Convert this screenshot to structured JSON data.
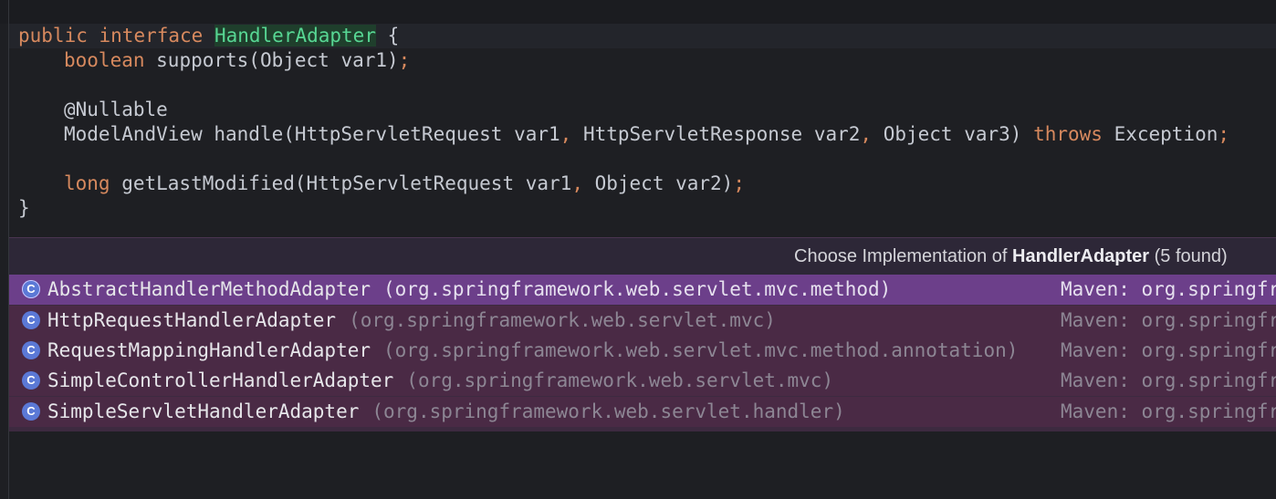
{
  "code": {
    "line1": {
      "kw1": "public",
      "kw2": "interface",
      "cls": "HandlerAdapter",
      "rest": " {"
    },
    "line2": {
      "type": "boolean",
      "rest": " supports(Object var1)",
      "semi": ";"
    },
    "line3": {
      "annotation": "@Nullable"
    },
    "line4": {
      "a": "ModelAndView handle(HttpServletRequest var1",
      "c1": ",",
      "b": " HttpServletResponse var2",
      "c2": ",",
      "d": " Object var3) ",
      "throws": "throws",
      "e": " Exception",
      "semi": ";"
    },
    "line5": {
      "type": "long",
      "a": " getLastModified(HttpServletRequest var1",
      "c1": ",",
      "b": " Object var2)",
      "semi": ";"
    },
    "line6": {
      "brace": "}"
    }
  },
  "popup": {
    "title_prefix": "Choose Implementation of ",
    "title_bold": "HandlerAdapter",
    "title_suffix": " (5 found)",
    "icon_letter": "C",
    "items": [
      {
        "name": "AbstractHandlerMethodAdapter",
        "package": "(org.springframework.web.servlet.mvc.method)",
        "library": "Maven: org.springframework"
      },
      {
        "name": "HttpRequestHandlerAdapter",
        "package": "(org.springframework.web.servlet.mvc)",
        "library": "Maven: org.springframework"
      },
      {
        "name": "RequestMappingHandlerAdapter",
        "package": "(org.springframework.web.servlet.mvc.method.annotation)",
        "library": "Maven: org.springframework"
      },
      {
        "name": "SimpleControllerHandlerAdapter",
        "package": "(org.springframework.web.servlet.mvc)",
        "library": "Maven: org.springframework"
      },
      {
        "name": "SimpleServletHandlerAdapter",
        "package": "(org.springframework.web.servlet.handler)",
        "library": "Maven: org.springframework"
      }
    ],
    "selected_index": 0
  },
  "colors": {
    "keyword": "#d7895e",
    "class_highlight": "#57d693",
    "popup_selected": "#6c3f8a",
    "popup_row": "#4a2a45",
    "class_icon": "#5b79d6"
  }
}
